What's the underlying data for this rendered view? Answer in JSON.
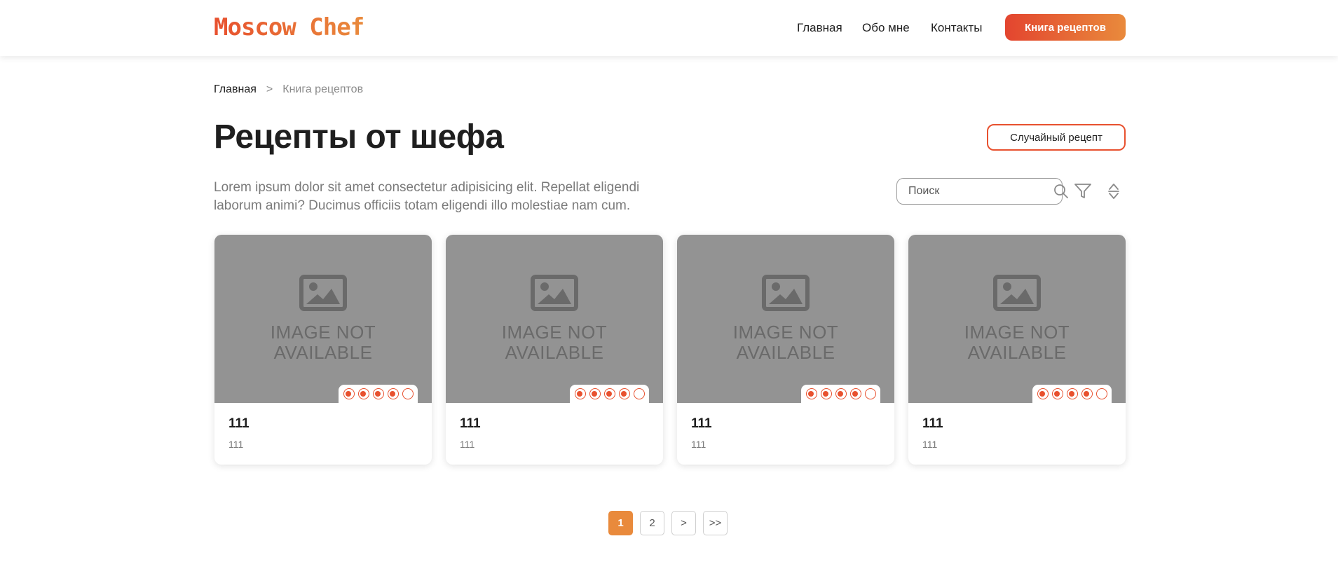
{
  "header": {
    "logo": "Moscow Chef",
    "nav": [
      {
        "label": "Главная"
      },
      {
        "label": "Обо мне"
      },
      {
        "label": "Контакты"
      }
    ],
    "cta_label": "Книга рецептов"
  },
  "breadcrumb": {
    "home": "Главная",
    "separator": ">",
    "current": "Книга рецептов"
  },
  "page": {
    "title": "Рецепты от шефа",
    "random_button": "Случайный рецепт",
    "description": "Lorem ipsum dolor sit amet consectetur adipisicing elit. Repellat eligendi laborum animi? Ducimus officiis totam eligendi illo molestiae nam cum."
  },
  "search": {
    "placeholder": "Поиск",
    "value": ""
  },
  "icons": {
    "search": "search-icon",
    "filter": "filter-icon",
    "sort": "sort-icon",
    "placeholder": "image-placeholder-icon"
  },
  "cards": [
    {
      "image_text_line1": "IMAGE NOT",
      "image_text_line2": "AVAILABLE",
      "title": "111",
      "subtitle": "111",
      "rating": 4,
      "rating_max": 5
    },
    {
      "image_text_line1": "IMAGE NOT",
      "image_text_line2": "AVAILABLE",
      "title": "111",
      "subtitle": "111",
      "rating": 4,
      "rating_max": 5
    },
    {
      "image_text_line1": "IMAGE NOT",
      "image_text_line2": "AVAILABLE",
      "title": "111",
      "subtitle": "111",
      "rating": 4,
      "rating_max": 5
    },
    {
      "image_text_line1": "IMAGE NOT",
      "image_text_line2": "AVAILABLE",
      "title": "111",
      "subtitle": "111",
      "rating": 4,
      "rating_max": 5
    }
  ],
  "pagination": {
    "pages": [
      "1",
      "2"
    ],
    "current": "1",
    "next": ">",
    "last": ">>"
  },
  "colors": {
    "accent": "#e8512f",
    "accent_end": "#e98a3c",
    "placeholder_bg": "#939393"
  }
}
